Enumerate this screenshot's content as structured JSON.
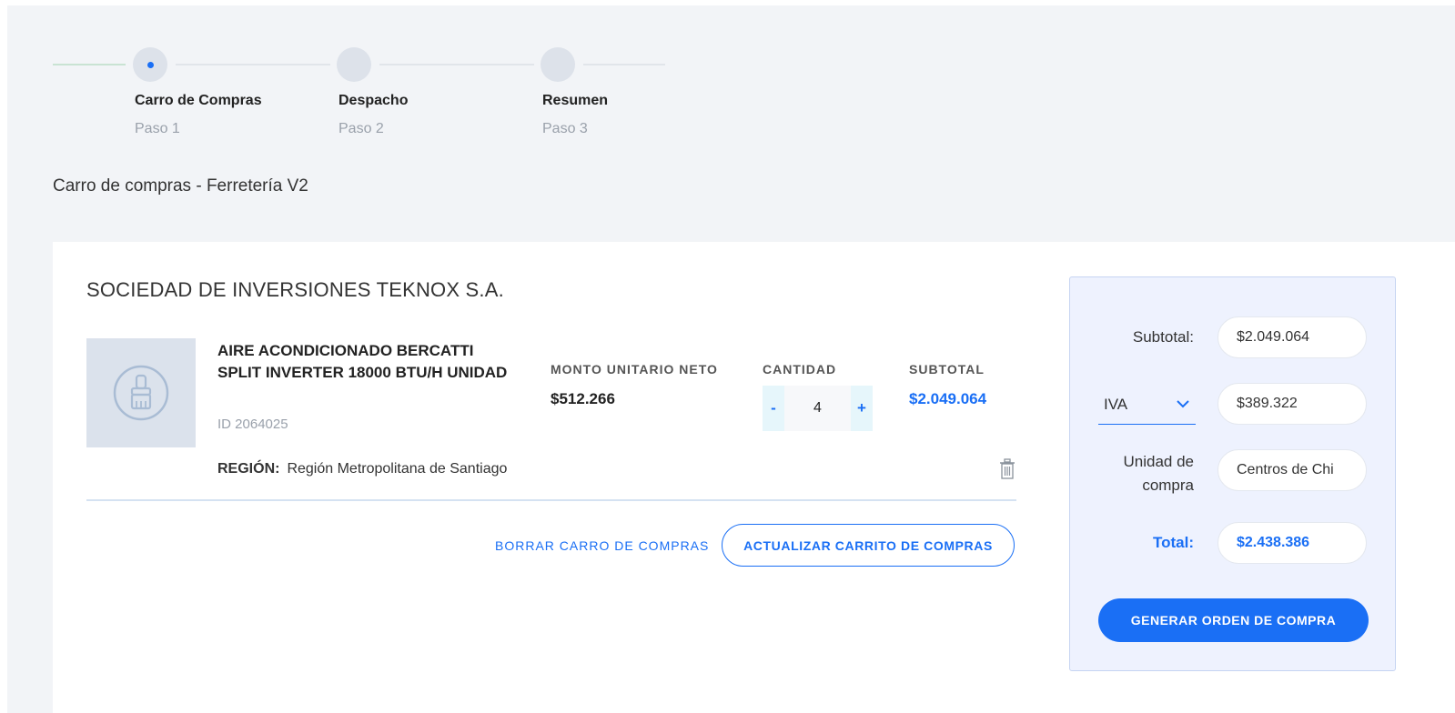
{
  "stepper": {
    "steps": [
      {
        "title": "Carro de Compras",
        "sub": "Paso 1"
      },
      {
        "title": "Despacho",
        "sub": "Paso 2"
      },
      {
        "title": "Resumen",
        "sub": "Paso 3"
      }
    ],
    "active_step": 1
  },
  "page": {
    "heading": "Carro de compras - Ferretería V2"
  },
  "cart": {
    "company": "SOCIEDAD DE INVERSIONES TEKNOX S.A.",
    "item": {
      "image_icon": "paint-brush-icon",
      "name": "AIRE ACONDICIONADO BERCATTI SPLIT INVERTER 18000 BTU/H UNIDAD",
      "id": "ID 2064025",
      "unit_price_label": "MONTO UNITARIO NETO",
      "unit_price": "$512.266",
      "quantity_label": "CANTIDAD",
      "quantity": "4",
      "minus": "-",
      "plus": "+",
      "subtotal_label": "SUBTOTAL",
      "subtotal": "$2.049.064",
      "region_label": "REGIÓN:",
      "region": "Región Metropolitana de Santiago",
      "delete_icon": "trash-icon"
    },
    "clear_label": "BORRAR CARRO DE COMPRAS",
    "update_label": "ACTUALIZAR CARRITO DE COMPRAS"
  },
  "summary": {
    "subtotal_label": "Subtotal:",
    "subtotal_value": "$2.049.064",
    "tax_select": "IVA",
    "tax_value": "$389.322",
    "unit_label_1": "Unidad de",
    "unit_label_2": "compra",
    "unit_value": "Centros de Chi",
    "total_label": "Total:",
    "total_value": "$2.438.386",
    "generate_label": "GENERAR ORDEN DE COMPRA"
  },
  "colors": {
    "accent": "#1a6ff5",
    "panel_bg": "#eef2fe",
    "page_bg": "#f2f4f7"
  }
}
